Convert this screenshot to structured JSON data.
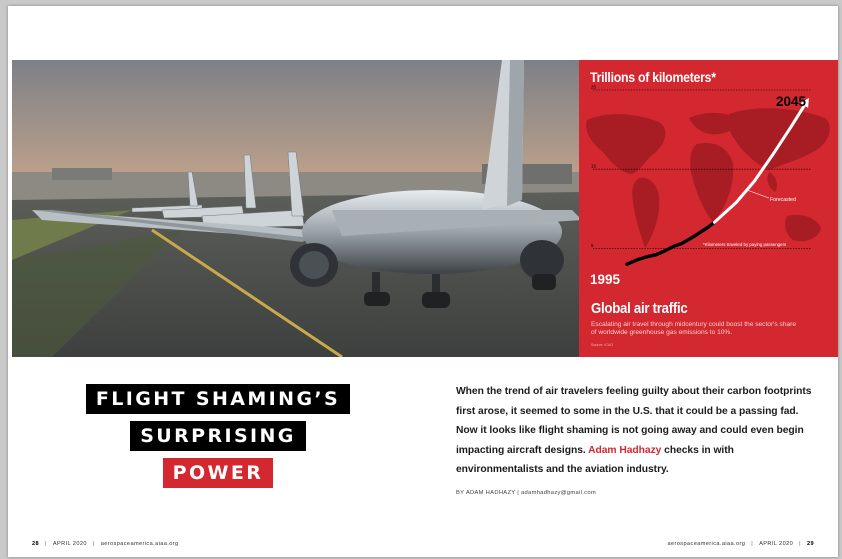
{
  "photo": {
    "subject": "airliners-queued-on-runway"
  },
  "chart": {
    "title": "Trillions of kilometers*",
    "start_label": "1995",
    "end_label": "2045",
    "forecasted_label": "Forecasted",
    "footnote": "*Kilometers traveled by paying passengers",
    "caption_title": "Global air traffic",
    "caption": "Escalating air travel through midcentury could boost the sector's share of worldwide greenhouse gas emissions to 10%.",
    "source": "Source: ICAO",
    "background_color": "#d3282f"
  },
  "chart_data": {
    "type": "line",
    "title": "Trillions of kilometers*",
    "x": [
      1995,
      1998,
      2001,
      2003,
      2005,
      2008,
      2010,
      2013,
      2015,
      2017,
      2019,
      2025,
      2030,
      2035,
      2040,
      2045
    ],
    "series": [
      {
        "name": "",
        "values": [
          3.0,
          3.6,
          4.0,
          4.2,
          4.6,
          5.3,
          5.6,
          6.4,
          7.0,
          7.6,
          8.3,
          10.8,
          13.5,
          16.8,
          20.3,
          24.0
        ]
      }
    ],
    "actual_end_index": 10,
    "yticks": [
      5,
      15,
      25
    ],
    "ylim": [
      0,
      25
    ],
    "xlim": [
      1995,
      2045
    ],
    "annotations": [
      "1995",
      "2045",
      "Forecasted",
      "*Kilometers traveled by paying passengers"
    ],
    "grid": true
  },
  "headline": {
    "line1": "FLIGHT SHAMING’S",
    "line2": "SURPRISING",
    "line3": "POWER"
  },
  "deck": {
    "text_before": "When the trend of air travelers feeling guilty about their carbon footprints first arose, it seemed to some in the U.S. that it could be a passing fad. Now it looks like flight shaming is not going away and could even begin impacting aircraft designs. ",
    "author": "Adam Hadhazy",
    "text_after": " checks in with environmentalists and the aviation industry."
  },
  "byline": "BY ADAM HADHAZY | adamhadhazy@gmail.com",
  "footer": {
    "left_page": "28",
    "left_date": "APRIL 2020",
    "left_site": "aerospaceamerica.aiaa.org",
    "right_site": "aerospaceamerica.aiaa.org",
    "right_date": "APRIL 2020",
    "right_page": "29"
  }
}
